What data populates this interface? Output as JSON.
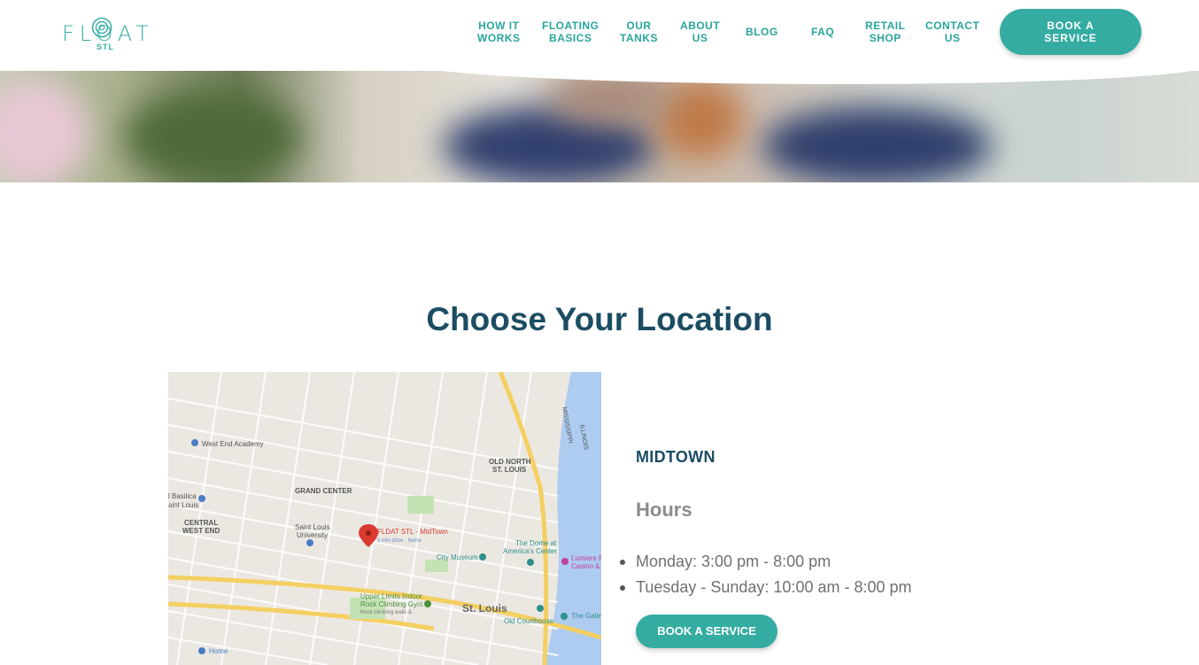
{
  "brand": {
    "name": "FLOAT",
    "sub": "STL",
    "accent": "#34aca2",
    "heading_color": "#1b4d63"
  },
  "nav": {
    "items": [
      {
        "label": "HOW IT\nWORKS"
      },
      {
        "label": "FLOATING\nBASICS"
      },
      {
        "label": "OUR\nTANKS"
      },
      {
        "label": "ABOUT\nUS"
      },
      {
        "label": "BLOG"
      },
      {
        "label": "FAQ"
      },
      {
        "label": "RETAIL\nSHOP"
      },
      {
        "label": "CONTACT\nUS"
      }
    ],
    "cta": "BOOK A\nSERVICE"
  },
  "main": {
    "title": "Choose Your Location",
    "location": {
      "name": "MIDTOWN",
      "hours_heading": "Hours",
      "hours": [
        "Monday: 3:00 pm - 8:00 pm",
        "Tuesday - Sunday: 10:00 am - 8:00 pm"
      ],
      "cta": "BOOK A SERVICE"
    },
    "map": {
      "labels": {
        "west_end_academy": "West End Academy",
        "basilica": "l Basilica",
        "saint_louis": "aint Louis",
        "central_west_end_1": "CENTRAL",
        "central_west_end_2": "WEST END",
        "grand_center": "GRAND CENTER",
        "slu_1": "Saint Louis",
        "slu_2": "University",
        "pin_title": "FLDAT STL - MidTown",
        "pin_sub": "5 min drive · home",
        "old_north_1": "OLD NORTH",
        "old_north_2": "ST. LOUIS",
        "city_museum": "City Museum",
        "dome_1": "The Dome at",
        "dome_2": "America's Center",
        "lumiere_1": "Lumiere Pl",
        "lumiere_2": "Casino &",
        "upper_limits_1": "Upper Limits Indoor",
        "upper_limits_2": "Rock Climbing Gym",
        "upper_limits_3": "Rock climbing walls &",
        "st_louis": "St. Louis",
        "old_courthouse": "Old Courthouse",
        "gateway": "The Gatev",
        "home": "Home",
        "mississippi": "MISSISSIPPI",
        "illinois": "ILLINOIS"
      }
    }
  }
}
